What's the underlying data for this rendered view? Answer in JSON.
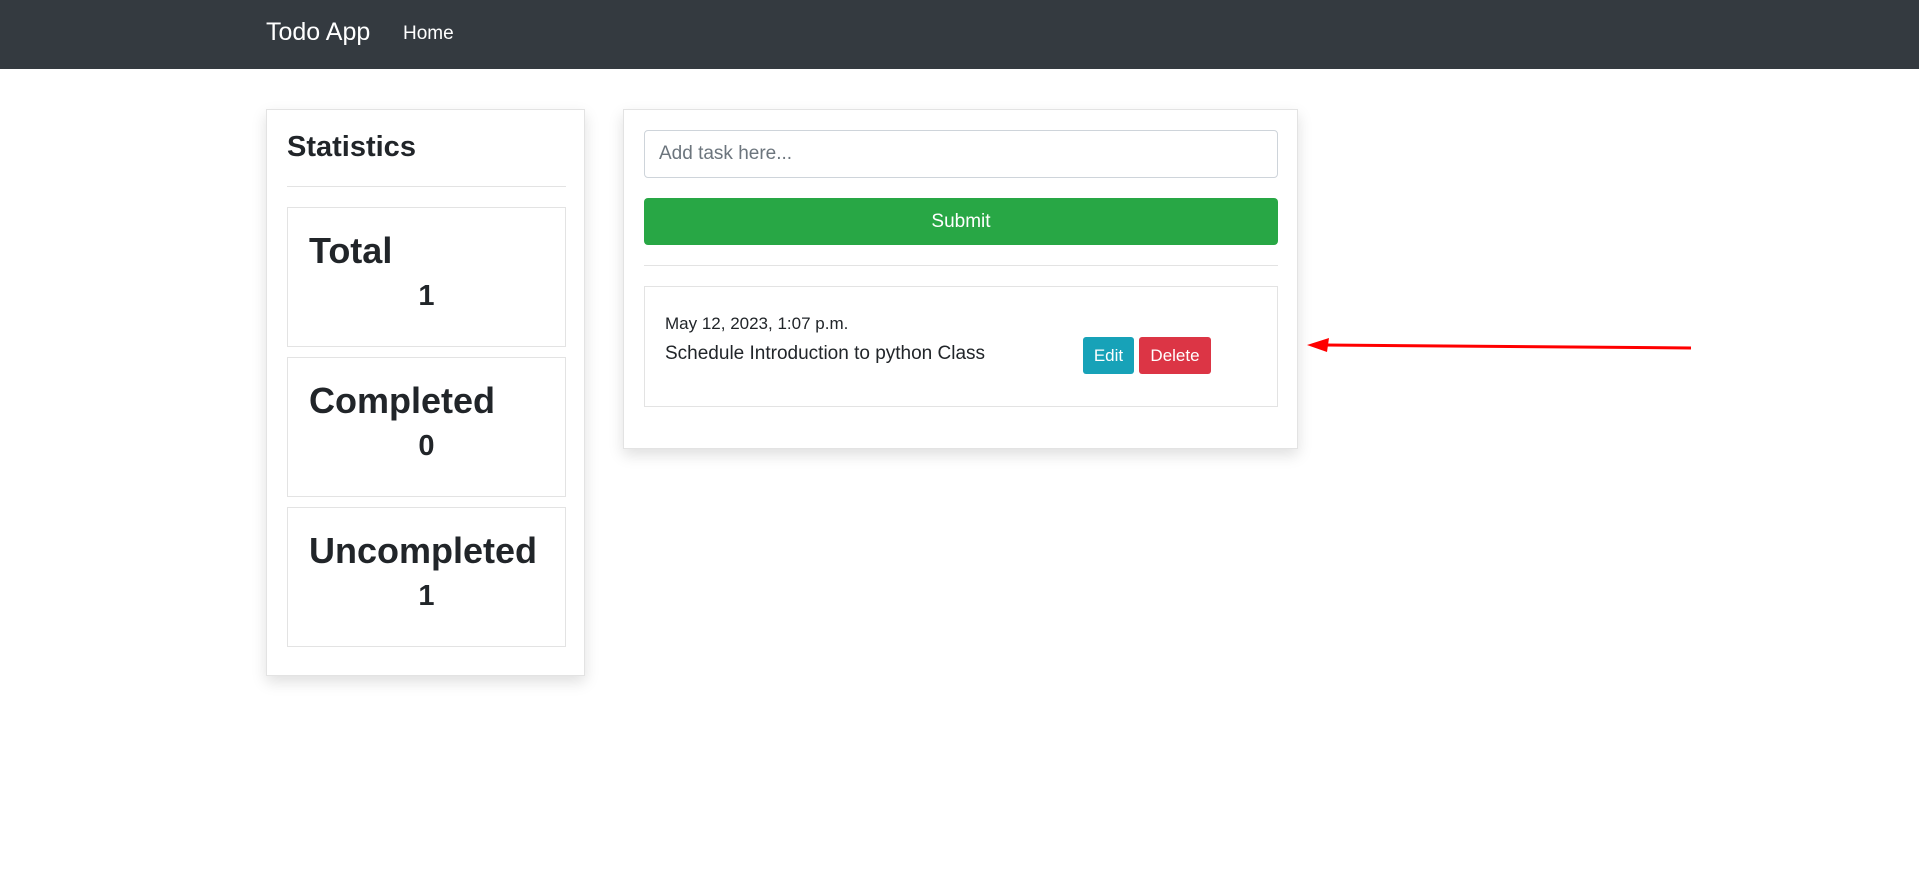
{
  "navbar": {
    "brand": "Todo App",
    "links": [
      {
        "label": "Home"
      }
    ]
  },
  "statistics": {
    "title": "Statistics",
    "items": [
      {
        "label": "Total",
        "value": "1"
      },
      {
        "label": "Completed",
        "value": "0"
      },
      {
        "label": "Uncompleted",
        "value": "1"
      }
    ]
  },
  "task_form": {
    "input_value": "",
    "placeholder": "Add task here...",
    "submit_label": "Submit"
  },
  "tasks": [
    {
      "date": "May 12, 2023, 1:07 p.m.",
      "text": "Schedule Introduction to python Class",
      "edit_label": "Edit",
      "delete_label": "Delete"
    }
  ],
  "colors": {
    "navbar_bg": "#343a40",
    "submit": "#28a745",
    "edit": "#17a2b8",
    "delete": "#dc3545",
    "annotation_arrow": "#ff0000"
  }
}
